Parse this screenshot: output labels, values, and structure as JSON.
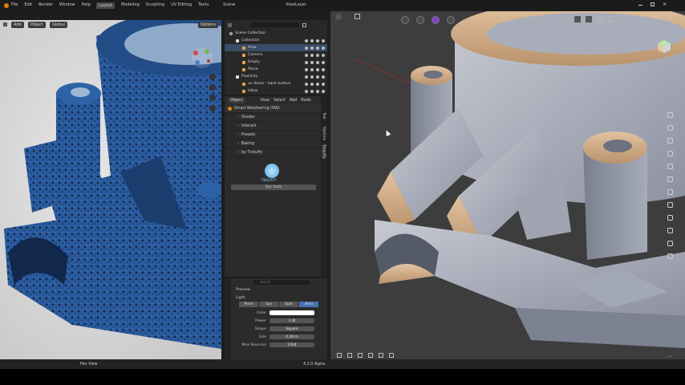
{
  "menu": {
    "items": [
      "File",
      "Edit",
      "Render",
      "Window",
      "Help"
    ]
  },
  "workspaces": [
    "Layout",
    "Modeling",
    "Sculpting",
    "UV Editing",
    "Textu"
  ],
  "active_workspace": "Layout",
  "scene": {
    "scene_label": "Scene",
    "view_layer_label": "ViewLayer"
  },
  "left_viewport": {
    "header": {
      "add": "Add",
      "object": "Object",
      "transform": "Global",
      "options": "Options"
    }
  },
  "outliner": {
    "search_placeholder": "",
    "rows": [
      {
        "label": "Scene Collection",
        "indent": 0,
        "selected": false
      },
      {
        "label": "Collection",
        "indent": 1,
        "selected": false
      },
      {
        "label": "Area",
        "indent": 2,
        "selected": true
      },
      {
        "label": "Camera",
        "indent": 2,
        "selected": false
      },
      {
        "label": "Empty",
        "indent": 2,
        "selected": false
      },
      {
        "label": "Plane",
        "indent": 2,
        "selected": false
      },
      {
        "label": "Pixelicity",
        "indent": 1,
        "selected": false
      },
      {
        "label": "uv demo - hard surface",
        "indent": 2,
        "selected": false
      },
      {
        "label": "Inbox",
        "indent": 2,
        "selected": false
      }
    ]
  },
  "npanel": {
    "header": {
      "object": "Object",
      "view": "View",
      "select": "Select",
      "add": "Add",
      "node": "Node"
    },
    "addon_title": "Smart Weathering (SW)",
    "sections": [
      "Shader",
      "Interact",
      "Presets",
      "Baking",
      "by Tinkuffy"
    ],
    "logo_text": "TINQUFFY",
    "button": "Our Insta",
    "tabs": [
      "Tool",
      "Options",
      "Tinquffy"
    ]
  },
  "properties": {
    "search_placeholder": "Search",
    "preview": "Preview",
    "light_section": "Light",
    "light_types": [
      "Point",
      "Sun",
      "Spot",
      "Area"
    ],
    "active_light_type": "Area",
    "fields": [
      {
        "label": "Color",
        "value": "",
        "swatch": "#ffffff"
      },
      {
        "label": "Power",
        "value": "2 W"
      },
      {
        "label": "Shape",
        "value": "Square"
      },
      {
        "label": "Size",
        "value": "0.28 m"
      },
      {
        "label": "Max Bounces",
        "value": "1024"
      }
    ]
  },
  "status": {
    "hint": "Pan View",
    "version": "4.2.0 Alpha"
  },
  "colors": {
    "accent": "#4772b3",
    "purple": "#7a43c9",
    "model_blue": "#2b5fa3",
    "clay": "#a7acb8"
  },
  "icons": [
    "blender-icon",
    "gear-icon",
    "eye-icon",
    "camera-icon",
    "light-icon",
    "pan-icon",
    "zoom-icon"
  ]
}
